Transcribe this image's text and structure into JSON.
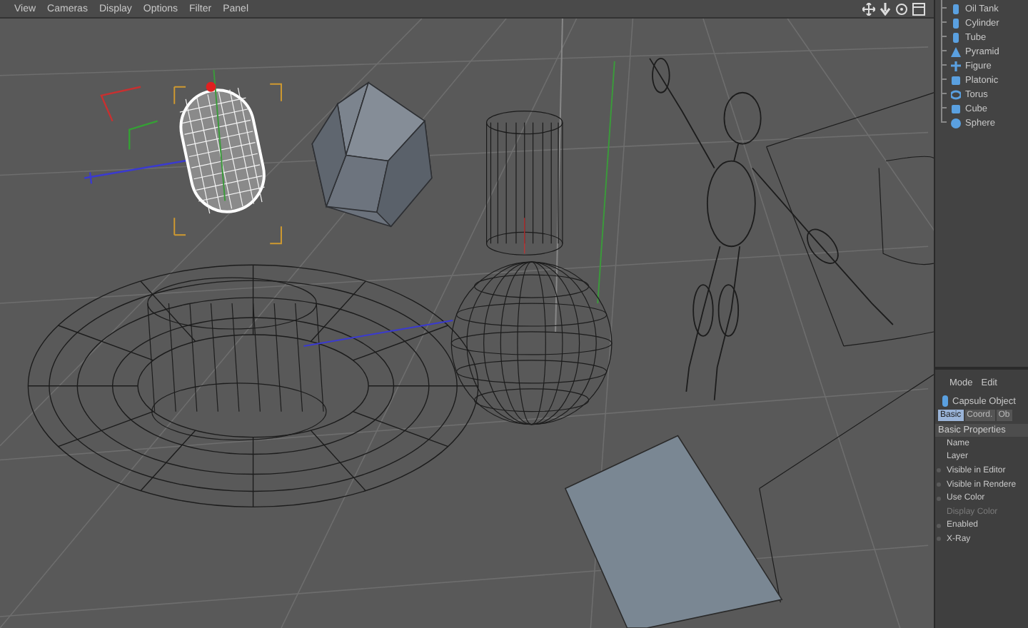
{
  "viewport": {
    "menu": [
      "View",
      "Cameras",
      "Display",
      "Options",
      "Filter",
      "Panel"
    ]
  },
  "object_list": [
    {
      "name": "Oil Tank",
      "kind": "tank"
    },
    {
      "name": "Cylinder",
      "kind": "cylinder"
    },
    {
      "name": "Tube",
      "kind": "tube"
    },
    {
      "name": "Pyramid",
      "kind": "pyramid"
    },
    {
      "name": "Figure",
      "kind": "figure"
    },
    {
      "name": "Platonic",
      "kind": "platonic"
    },
    {
      "name": "Torus",
      "kind": "torus"
    },
    {
      "name": "Cube",
      "kind": "cube"
    },
    {
      "name": "Sphere",
      "kind": "sphere"
    }
  ],
  "attributes": {
    "menu": [
      "Mode",
      "Edit"
    ],
    "object_title": "Capsule Object",
    "tabs": [
      {
        "label": "Basic",
        "selected": true
      },
      {
        "label": "Coord.",
        "selected": false
      },
      {
        "label": "Ob",
        "selected": false
      }
    ],
    "section": "Basic Properties",
    "fields": [
      {
        "label": "Name",
        "disabled": false,
        "kind": "text"
      },
      {
        "label": "Layer",
        "disabled": false,
        "kind": "text"
      },
      {
        "label": "Visible in Editor",
        "disabled": false,
        "kind": "option"
      },
      {
        "label": "Visible in Rendere",
        "disabled": false,
        "kind": "option"
      },
      {
        "label": "Use Color",
        "disabled": false,
        "kind": "option"
      },
      {
        "label": "Display Color",
        "disabled": true,
        "kind": "text"
      },
      {
        "label": "Enabled",
        "disabled": false,
        "kind": "option"
      },
      {
        "label": "X-Ray",
        "disabled": false,
        "kind": "option"
      }
    ]
  }
}
